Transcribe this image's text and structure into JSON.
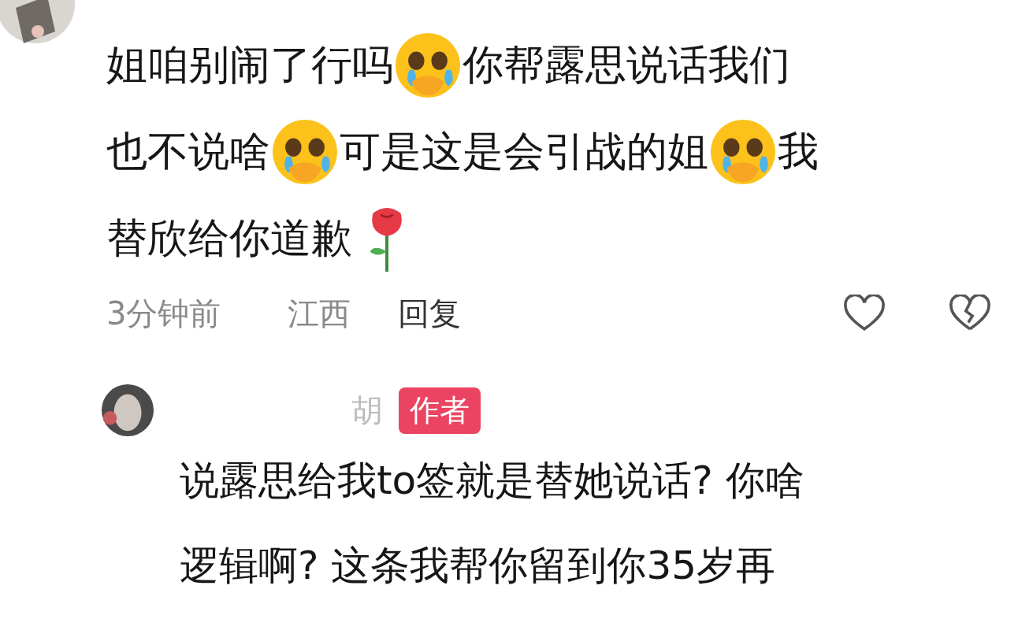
{
  "comments": [
    {
      "lines": [
        [
          {
            "kind": "text",
            "text": "姐咱别闹了行吗"
          },
          {
            "kind": "cry"
          },
          {
            "kind": "text",
            "text": "你帮露思说话我们"
          }
        ],
        [
          {
            "kind": "text",
            "text": "也不说啥"
          },
          {
            "kind": "cry"
          },
          {
            "kind": "text",
            "text": "可是这是会引战的姐"
          },
          {
            "kind": "cry"
          },
          {
            "kind": "text",
            "text": "我"
          }
        ],
        [
          {
            "kind": "text",
            "text": "替欣给你道歉"
          },
          {
            "kind": "rose"
          }
        ]
      ],
      "time": "3分钟前",
      "location": "江西",
      "reply": "回复"
    },
    {
      "name": "胡",
      "badge": "作者",
      "lines": [
        [
          {
            "kind": "text",
            "text": "说露思给我to签就是替她说话? 你啥"
          }
        ],
        [
          {
            "kind": "text",
            "text": "逻辑啊? 这条我帮你留到你35岁再"
          }
        ]
      ]
    }
  ]
}
